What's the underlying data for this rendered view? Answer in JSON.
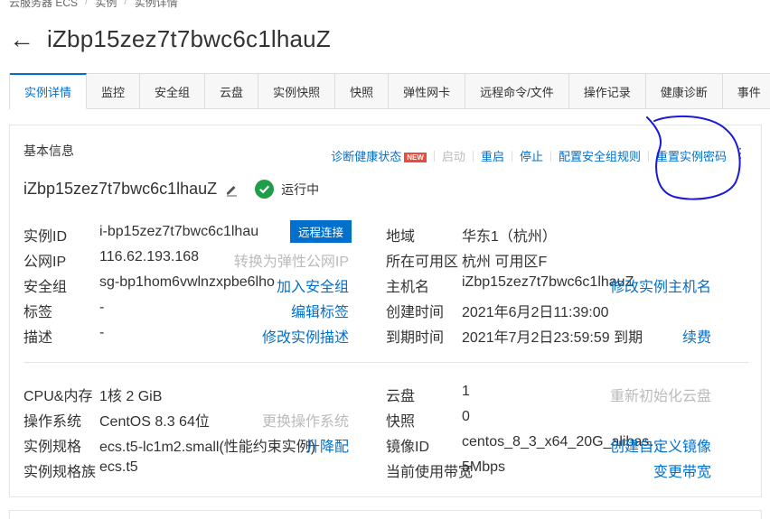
{
  "breadcrumb": [
    "云服务器 ECS",
    "实例",
    "实例详情"
  ],
  "page_title": "iZbp15zez7t7bwc6c1lhauZ",
  "tabs": [
    "实例详情",
    "监控",
    "安全组",
    "云盘",
    "实例快照",
    "快照",
    "弹性网卡",
    "远程命令/文件",
    "操作记录",
    "健康诊断",
    "事件"
  ],
  "section_title": "基本信息",
  "actions": {
    "diagnose": "诊断健康状态",
    "new_badge": "NEW",
    "start": "启动",
    "restart": "重启",
    "stop": "停止",
    "config_sg": "配置安全组规则",
    "reset_pwd": "重置实例密码"
  },
  "instance": {
    "name": "iZbp15zez7t7bwc6c1lhauZ",
    "status": "运行中"
  },
  "info": {
    "id_label": "实例ID",
    "id_value": "i-bp15zez7t7bwc6c1lhau",
    "remote_btn": "远程连接",
    "ip_label": "公网IP",
    "ip_value": "116.62.193.168",
    "eip_link": "转换为弹性公网IP",
    "sg_label": "安全组",
    "sg_value": "sg-bp1hom6vwlnzxpbe6lho",
    "sg_link": "加入安全组",
    "tag_label": "标签",
    "tag_value": "-",
    "tag_link": "编辑标签",
    "desc_label": "描述",
    "desc_value": "-",
    "desc_link": "修改实例描述",
    "region_label": "地域",
    "region_value": "华东1（杭州）",
    "zone_label": "所在可用区",
    "zone_value": "杭州 可用区F",
    "host_label": "主机名",
    "host_value": "iZbp15zez7t7bwc6c1lhauZ",
    "host_link": "修改实例主机名",
    "created_label": "创建时间",
    "created_value": "2021年6月2日11:39:00",
    "expire_label": "到期时间",
    "expire_value": "2021年7月2日23:59:59 到期",
    "renew_link": "续费"
  },
  "config": {
    "cpu_label": "CPU&内存",
    "cpu_value": "1核 2 GiB",
    "os_label": "操作系统",
    "os_value": "CentOS 8.3 64位",
    "os_link": "更换操作系统",
    "spec_label": "实例规格",
    "spec_value": "ecs.t5-lc1m2.small(性能约束实例)",
    "spec_link": "升降配",
    "family_label": "实例规格族",
    "family_value": "ecs.t5",
    "disk_label": "云盘",
    "disk_value": "1",
    "disk_link": "重新初始化云盘",
    "snap_label": "快照",
    "snap_value": "0",
    "image_label": "镜像ID",
    "image_value": "centos_8_3_x64_20G_alibas…",
    "image_link": "创建自定义镜像",
    "bw_label": "当前使用带宽",
    "bw_value": "5Mbps",
    "bw_link": "变更带宽"
  },
  "colors": {
    "accent": "#0070cc",
    "status_ok": "#1e9e4a",
    "annotation": "#1a1adb"
  },
  "icons": {
    "back": "arrow-left-icon",
    "edit": "pencil-icon",
    "status": "check-circle-icon",
    "more": "more-vertical-icon"
  }
}
